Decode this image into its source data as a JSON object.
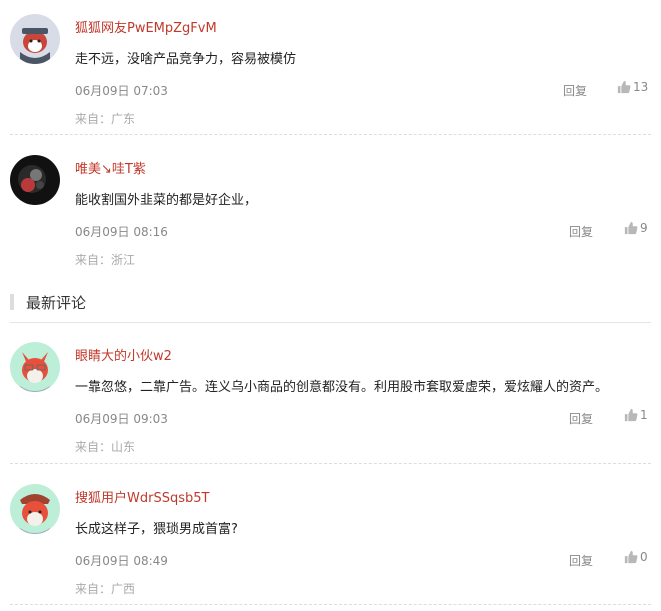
{
  "hot_comments": [
    {
      "username": "狐狐网友PwEMpZgFvM",
      "text": "走不远，没啥产品竞争力，容易被模仿",
      "time": "06月09日 07:03",
      "reply_label": "回复",
      "likes": "13",
      "location": "来自：广东"
    },
    {
      "username": "唯美↘哇T紫",
      "text": "能收割国外韭菜的都是好企业，",
      "time": "06月09日 08:16",
      "reply_label": "回复",
      "likes": "9",
      "location": "来自：浙江"
    }
  ],
  "latest_section": {
    "title": "最新评论"
  },
  "latest_comments": [
    {
      "username": "眼睛大的小伙w2",
      "text": "一靠忽悠，二靠广告。连义乌小商品的创意都没有。利用股市套取爱虚荣，爱炫耀人的资产。",
      "time": "06月09日 09:03",
      "reply_label": "回复",
      "likes": "1",
      "location": "来自：山东"
    },
    {
      "username": "搜狐用户WdrSSqsb5T",
      "text": "长成这样子，猥琐男成首富?",
      "time": "06月09日 08:49",
      "reply_label": "回复",
      "likes": "0",
      "location": "来自：广西"
    }
  ],
  "colors": {
    "username": "#c0392b",
    "meta": "#888888",
    "location": "#aaaaaa"
  }
}
